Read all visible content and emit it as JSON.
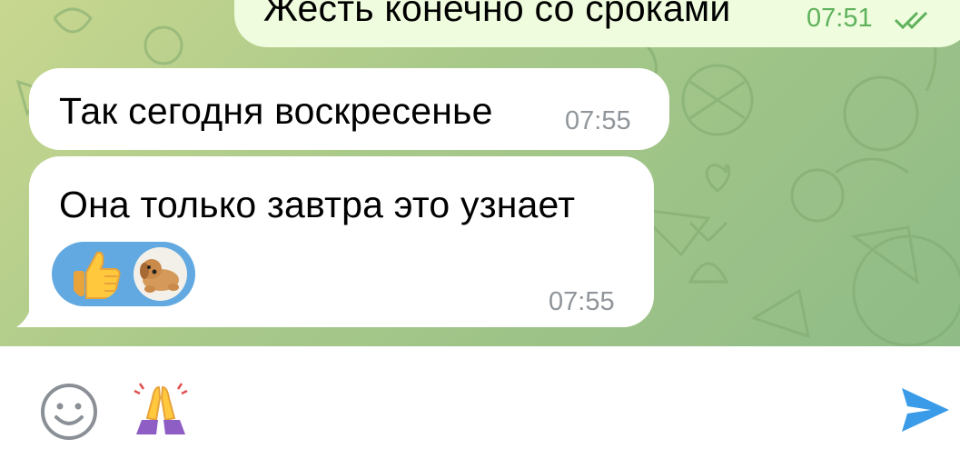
{
  "messages": [
    {
      "direction": "outgoing",
      "text": "Жесть конечно со сроками",
      "time": "07:51",
      "status": "read-double-check"
    },
    {
      "direction": "incoming",
      "text": "Так сегодня воскресенье",
      "time": "07:55"
    },
    {
      "direction": "incoming",
      "text": "Она только завтра это узнает",
      "time": "07:55",
      "reactions": [
        {
          "emoji": "thumbs-up",
          "icon": "thumbs-up-icon"
        },
        {
          "emoji": "dog-plush",
          "icon": "dog-avatar-icon"
        }
      ]
    }
  ],
  "input_bar": {
    "emoji_button": "smiley-icon",
    "quick_emoji": "folded-hands-icon",
    "send_button": "send-icon"
  },
  "colors": {
    "incoming_bubble": "#ffffff",
    "outgoing_bubble": "#effdde",
    "outgoing_time": "#5fb15c",
    "reaction_pill": "#61a9e0",
    "send_icon": "#3a9be8",
    "emoji_button": "#8a9096"
  }
}
